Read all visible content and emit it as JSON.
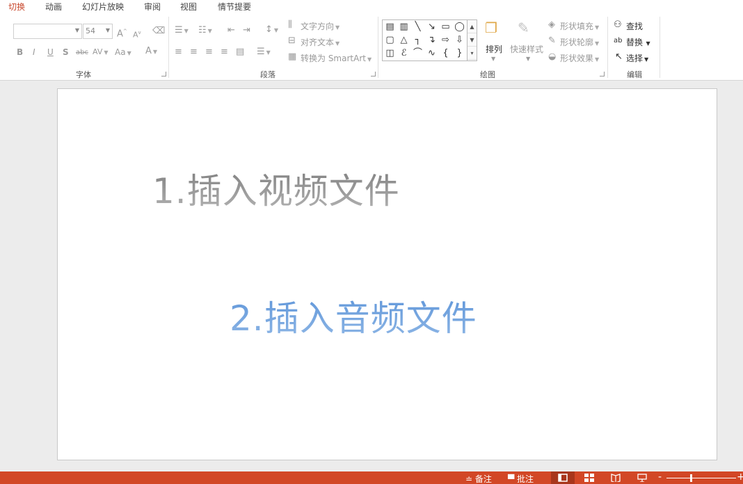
{
  "tabs": [
    "切换",
    "动画",
    "幻灯片放映",
    "审阅",
    "视图",
    "情节提要"
  ],
  "ribbon": {
    "font_group_label": "字体",
    "paragraph_group_label": "段落",
    "drawing_group_label": "绘图",
    "editing_group_label": "编辑",
    "font_name": "",
    "font_size": "54",
    "text_direction": "文字方向",
    "align_text": "对齐文本",
    "convert_smartart": "转换为 SmartArt",
    "arrange": "排列",
    "quick_styles": "快速样式",
    "shape_fill": "形状填充",
    "shape_outline": "形状轮廓",
    "shape_effects": "形状效果",
    "find": "查找",
    "replace": "替换",
    "select": "选择",
    "bold": "B",
    "italic": "I",
    "underline": "U",
    "shadow": "S",
    "strike": "abc",
    "spacing": "AV",
    "case": "Aa",
    "font_color": "A",
    "grow": "A",
    "shrink": "A"
  },
  "slide": {
    "line1": "1.插入视频文件",
    "line2": "2.插入音频文件"
  },
  "status": {
    "notes": "备注",
    "comments": "批注"
  },
  "colors": {
    "accent": "#d24726",
    "active_tab": "#c8472c",
    "text2": "#5b93d8"
  }
}
